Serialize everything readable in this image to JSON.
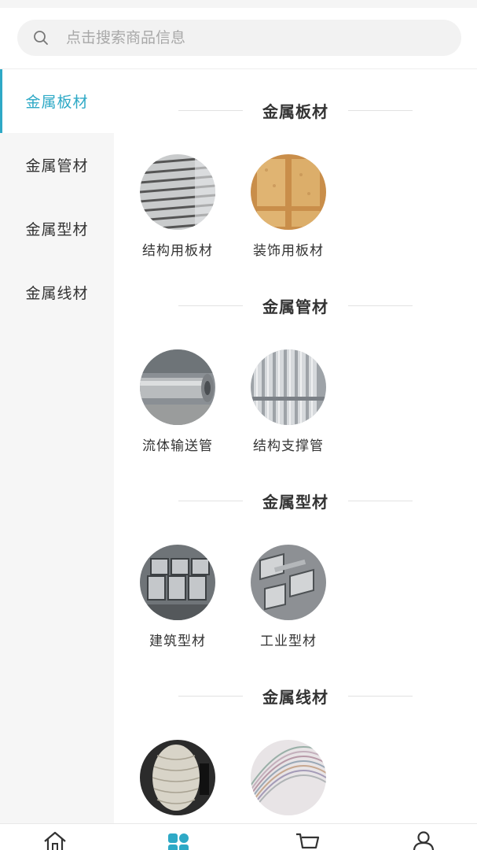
{
  "search": {
    "placeholder": "点击搜索商品信息"
  },
  "sidebar": {
    "items": [
      {
        "label": "金属板材",
        "active": true
      },
      {
        "label": "金属管材",
        "active": false
      },
      {
        "label": "金属型材",
        "active": false
      },
      {
        "label": "金属线材",
        "active": false
      }
    ]
  },
  "sections": [
    {
      "title": "金属板材",
      "items": [
        {
          "label": "结构用板材"
        },
        {
          "label": "装饰用板材"
        }
      ]
    },
    {
      "title": "金属管材",
      "items": [
        {
          "label": "流体输送管"
        },
        {
          "label": "结构支撑管"
        }
      ]
    },
    {
      "title": "金属型材",
      "items": [
        {
          "label": "建筑型材"
        },
        {
          "label": "工业型材"
        }
      ]
    },
    {
      "title": "金属线材",
      "items": [
        {
          "label": ""
        },
        {
          "label": ""
        }
      ]
    }
  ],
  "tabbar": {
    "items": [
      {
        "icon": "home-icon",
        "active": false
      },
      {
        "icon": "category-icon",
        "active": true
      },
      {
        "icon": "cart-icon",
        "active": false
      },
      {
        "icon": "user-icon",
        "active": false
      }
    ]
  },
  "colors": {
    "accent": "#2ea9c6",
    "sidebar_bg": "#f6f6f6",
    "search_bg": "#f2f2f2"
  }
}
